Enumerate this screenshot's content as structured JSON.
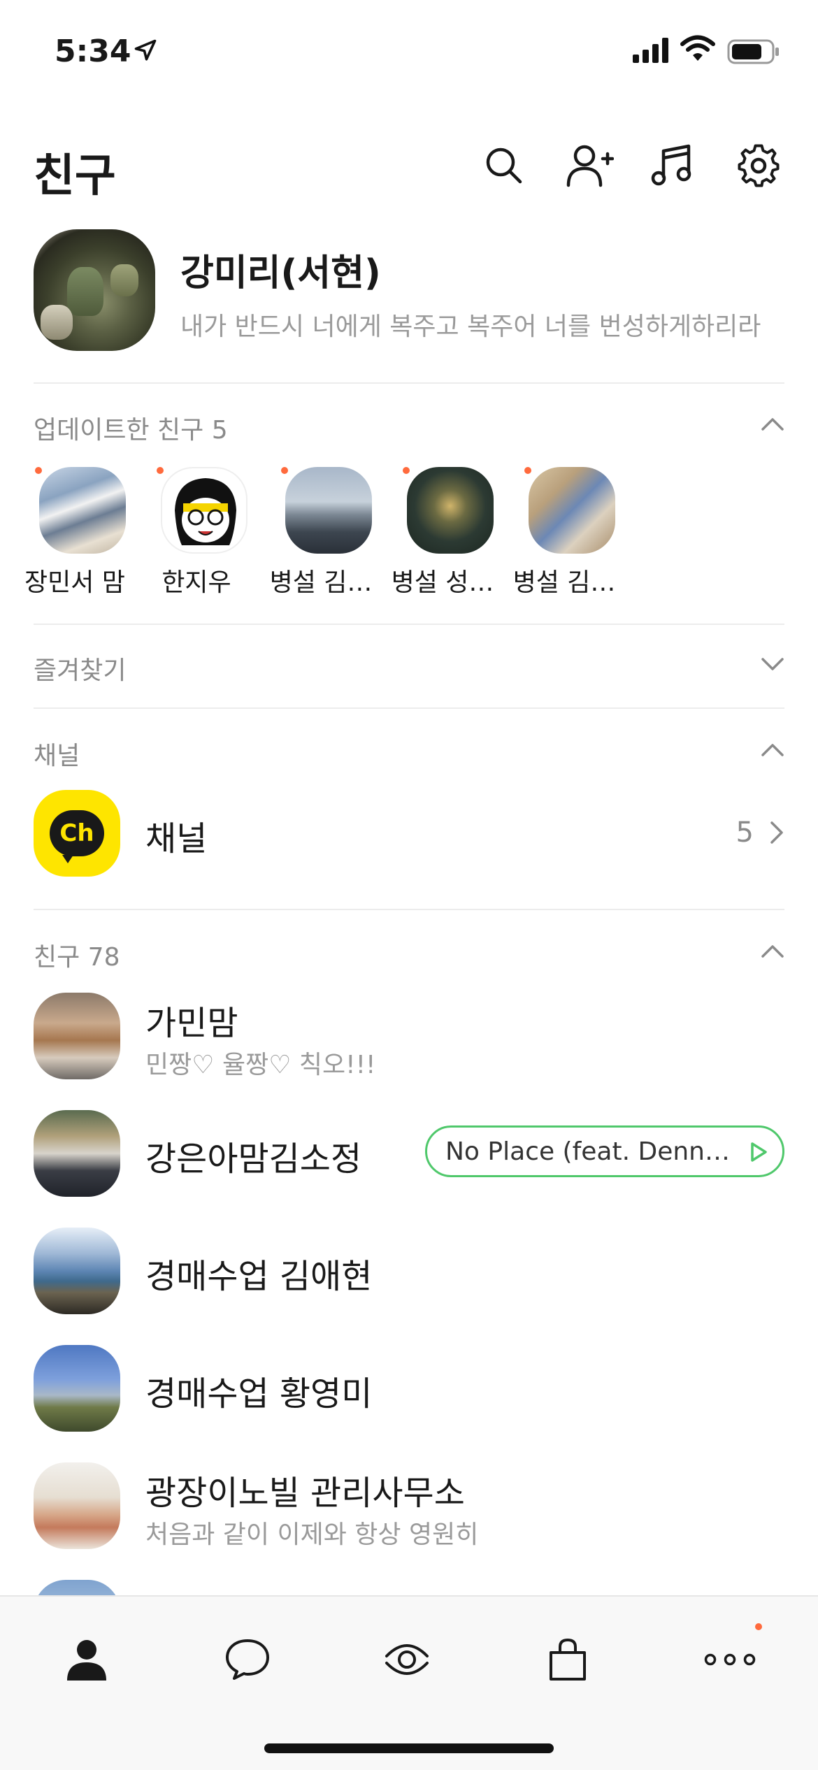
{
  "status_bar": {
    "time": "5:34"
  },
  "header": {
    "title": "친구",
    "icons": [
      "search-icon",
      "add-friend-icon",
      "music-icon",
      "settings-icon"
    ]
  },
  "my_profile": {
    "name": "강미리(서현)",
    "status": "내가 반드시 너에게 복주고  복주어 너를 번성하게하리라"
  },
  "updated_friends": {
    "label": "업데이트한 친구 5",
    "items": [
      {
        "name": "장민서 맘"
      },
      {
        "name": "한지우"
      },
      {
        "name": "병설 김…"
      },
      {
        "name": "병설 성…"
      },
      {
        "name": "병설 김…"
      }
    ]
  },
  "favorites": {
    "label": "즐겨찾기"
  },
  "channel_section": {
    "label": "채널",
    "icon_text": "Ch",
    "name": "채널",
    "count": "5"
  },
  "friends": {
    "label": "친구 78",
    "items": [
      {
        "name": "가민맘",
        "status": "민짱♡ 율짱♡ 칙오!!!"
      },
      {
        "name": "강은아맘김소정",
        "music": "No Place (feat. Dennis Kim)"
      },
      {
        "name": "경매수업 김애현"
      },
      {
        "name": "경매수업 황영미"
      },
      {
        "name": "광장이노빌 관리사무소",
        "status": "처음과 같이 이제와 항상 영원히"
      }
    ]
  },
  "tab_bar": {
    "tabs": [
      "friends-tab",
      "chats-tab",
      "view-tab",
      "shopping-tab",
      "more-tab"
    ],
    "accent": "#ff6a3d"
  },
  "colors": {
    "channel_yellow": "#fee500",
    "music_green": "#4fc86b",
    "notification_dot": "#ff6a3d"
  }
}
